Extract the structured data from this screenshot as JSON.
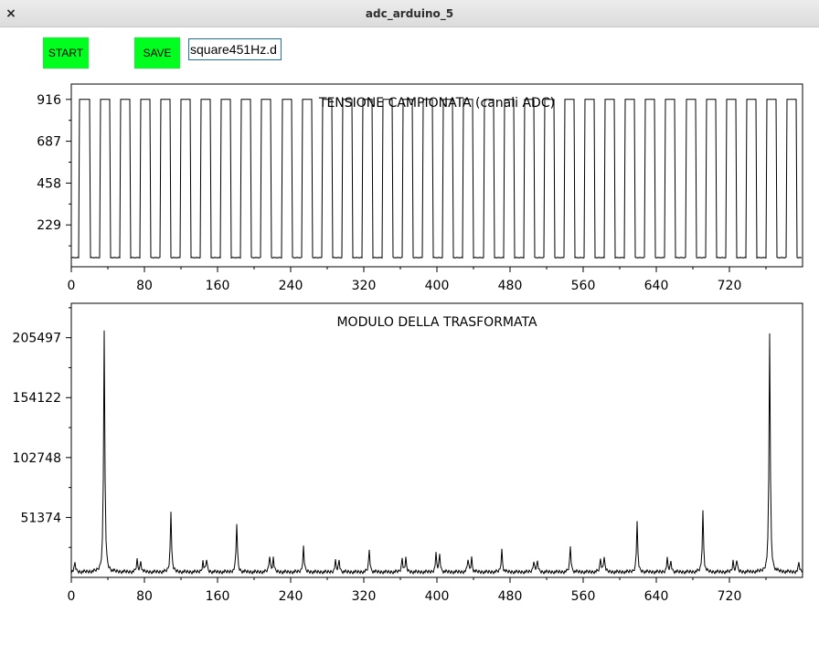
{
  "window": {
    "title": "adc_arduino_5",
    "close_label": "×"
  },
  "toolbar": {
    "start_label": "START",
    "save_label": "SAVE",
    "filename_value": "square451Hz.d"
  },
  "chart_data": [
    {
      "type": "line",
      "title": "TENSIONE CAMPIONATA (canali ADC)",
      "xlabel": "",
      "ylabel": "",
      "xlim": [
        0,
        800
      ],
      "ylim": [
        0,
        1000
      ],
      "x_ticks": [
        "0",
        "80",
        "160",
        "240",
        "320",
        "400",
        "480",
        "560",
        "640",
        "720"
      ],
      "y_ticks": [
        "229",
        "458",
        "687",
        "916"
      ],
      "series": [
        {
          "signal": "square",
          "period_samples": 22.1,
          "high": 916,
          "low": 50,
          "first_rise": 9,
          "samples": 800
        }
      ]
    },
    {
      "type": "line",
      "title": "MODULO DELLA TRASFORMATA",
      "xlabel": "",
      "ylabel": "",
      "xlim": [
        0,
        800
      ],
      "ylim": [
        0,
        235000
      ],
      "x_ticks": [
        "0",
        "80",
        "160",
        "240",
        "320",
        "400",
        "480",
        "560",
        "640",
        "720"
      ],
      "y_ticks": [
        "51374",
        "102748",
        "154122",
        "205497"
      ],
      "series": [
        {
          "baseline": 3000,
          "peaks": [
            {
              "x": 36,
              "y": 205497
            },
            {
              "x": 72,
              "y": 10000
            },
            {
              "x": 76,
              "y": 9000
            },
            {
              "x": 109,
              "y": 52000
            },
            {
              "x": 144,
              "y": 9000
            },
            {
              "x": 148,
              "y": 11000
            },
            {
              "x": 181,
              "y": 42000
            },
            {
              "x": 217,
              "y": 14000
            },
            {
              "x": 221,
              "y": 12000
            },
            {
              "x": 254,
              "y": 22000
            },
            {
              "x": 289,
              "y": 9000
            },
            {
              "x": 293,
              "y": 10000
            },
            {
              "x": 326,
              "y": 19000
            },
            {
              "x": 362,
              "y": 12000
            },
            {
              "x": 366,
              "y": 11000
            },
            {
              "x": 399,
              "y": 15000
            },
            {
              "x": 403,
              "y": 15000
            },
            {
              "x": 434,
              "y": 11000
            },
            {
              "x": 438,
              "y": 12000
            },
            {
              "x": 471,
              "y": 19000
            },
            {
              "x": 506,
              "y": 10000
            },
            {
              "x": 510,
              "y": 9000
            },
            {
              "x": 546,
              "y": 22000
            },
            {
              "x": 579,
              "y": 11000
            },
            {
              "x": 583,
              "y": 14000
            },
            {
              "x": 619,
              "y": 42000
            },
            {
              "x": 652,
              "y": 11000
            },
            {
              "x": 656,
              "y": 9000
            },
            {
              "x": 691,
              "y": 52000
            },
            {
              "x": 724,
              "y": 9000
            },
            {
              "x": 728,
              "y": 10000
            },
            {
              "x": 764,
              "y": 205497
            },
            {
              "x": 796,
              "y": 8000
            },
            {
              "x": 4,
              "y": 8000
            }
          ]
        }
      ]
    }
  ]
}
